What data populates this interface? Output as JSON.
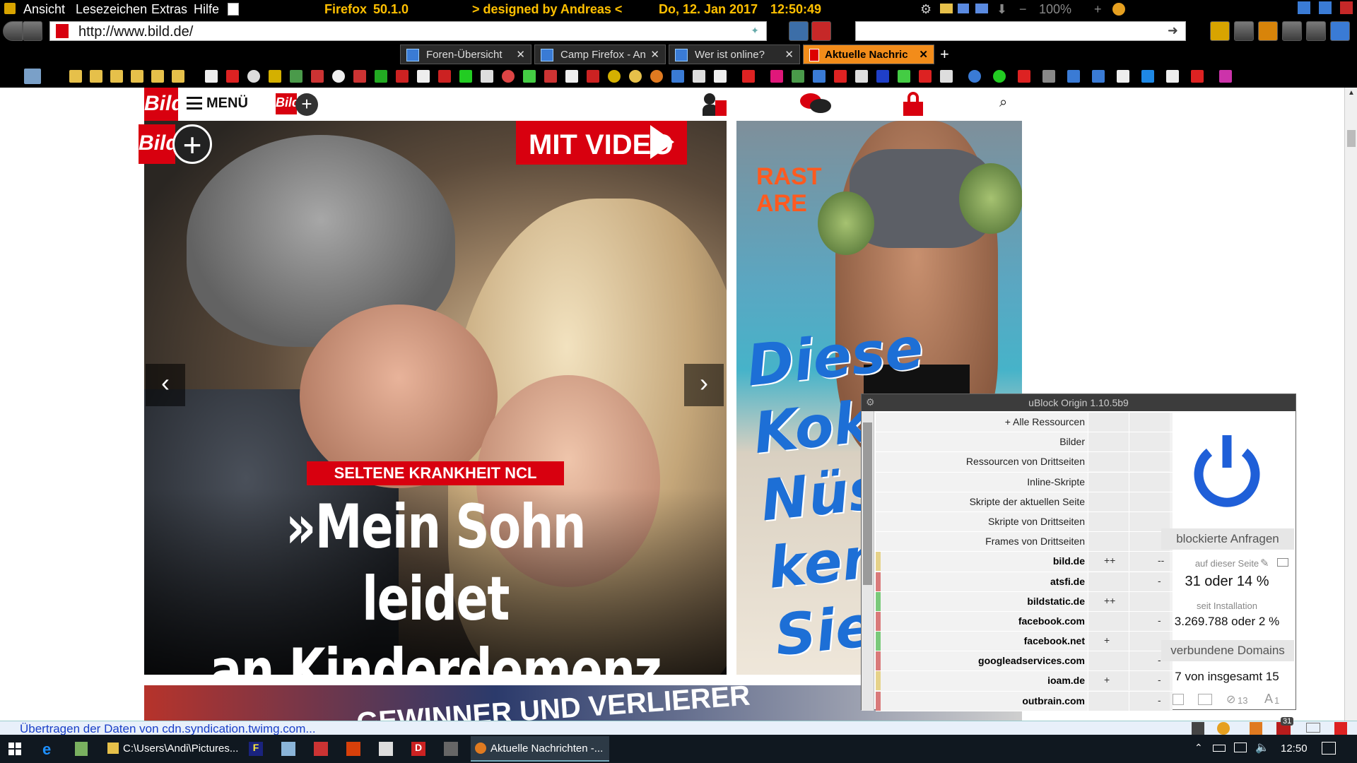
{
  "menubar": {
    "menus": [
      "Ansicht",
      "Lesezeichen",
      "Extras",
      "Hilfe"
    ],
    "browser": "Firefox",
    "version": "50.1.0",
    "designed": "> designed by Andreas <",
    "date": "Do, 12. Jan 2017",
    "time": "12:50:49",
    "zoom": "100%"
  },
  "navbar": {
    "url": "http://www.bild.de/",
    "search_value": ""
  },
  "tabs": [
    {
      "label": "Foren-Übersicht",
      "active": false
    },
    {
      "label": "Camp Firefox - An",
      "active": false
    },
    {
      "label": "Wer ist online?",
      "active": false
    },
    {
      "label": "Aktuelle Nachric",
      "active": true
    }
  ],
  "site": {
    "logo": "Bild",
    "menu_label": "MENÜ",
    "plus_logo": "Bild",
    "video_badge": "MIT VIDEO",
    "kicker": "SELTENE KRANKHEIT NCL",
    "headline_line1": "»Mein Sohn leidet",
    "headline_line2": "an Kinderdemenz",
    "ad_stars": "RASTARE",
    "ad_lines": [
      "Diese",
      "Koko",
      "Nüss",
      "kenne",
      "Sie..."
    ],
    "teaser_title": "GEWINNER UND VERLIERER"
  },
  "ublock": {
    "title": "uBlock Origin 1.10.5b9",
    "rows": [
      {
        "label": "+ Alle Ressourcen",
        "c1": "",
        "c2": "",
        "domain": false,
        "mark": ""
      },
      {
        "label": "Bilder",
        "c1": "",
        "c2": "",
        "domain": false,
        "mark": ""
      },
      {
        "label": "Ressourcen von Drittseiten",
        "c1": "",
        "c2": "",
        "domain": false,
        "mark": ""
      },
      {
        "label": "Inline-Skripte",
        "c1": "",
        "c2": "",
        "domain": false,
        "mark": ""
      },
      {
        "label": "Skripte der aktuellen Seite",
        "c1": "",
        "c2": "",
        "domain": false,
        "mark": ""
      },
      {
        "label": "Skripte von Drittseiten",
        "c1": "",
        "c2": "",
        "domain": false,
        "mark": ""
      },
      {
        "label": "Frames von Drittseiten",
        "c1": "",
        "c2": "",
        "domain": false,
        "mark": ""
      },
      {
        "label": "bild.de",
        "c1": "++",
        "c2": "--",
        "domain": true,
        "mark": "#e6d28a"
      },
      {
        "label": "atsfi.de",
        "c1": "",
        "c2": "-",
        "domain": true,
        "mark": "#d97a7a"
      },
      {
        "label": "bildstatic.de",
        "c1": "++",
        "c2": "",
        "domain": true,
        "mark": "#7ac97a"
      },
      {
        "label": "facebook.com",
        "c1": "",
        "c2": "-",
        "domain": true,
        "mark": "#d97a7a"
      },
      {
        "label": "facebook.net",
        "c1": "+",
        "c2": "",
        "domain": true,
        "mark": "#7ac97a"
      },
      {
        "label": "googleadservices.com",
        "c1": "",
        "c2": "-",
        "domain": true,
        "mark": "#d97a7a"
      },
      {
        "label": "ioam.de",
        "c1": "+",
        "c2": "-",
        "domain": true,
        "mark": "#e6d28a"
      },
      {
        "label": "outbrain.com",
        "c1": "",
        "c2": "-",
        "domain": true,
        "mark": "#d97a7a"
      }
    ],
    "blocked_header": "blockierte Anfragen",
    "on_page_label": "auf dieser Seite",
    "on_page_value": "31 oder 14 %",
    "since_install_label": "seit Installation",
    "since_install_value": "3.269.788 oder 2 %",
    "domains_header": "verbundene Domains",
    "domains_value": "7 von insgesamt 15",
    "tool_count_1": "13",
    "tool_count_2": "1",
    "power_color": "#1f5fd8"
  },
  "status": {
    "text": "Übertragen der Daten von cdn.syndication.twimg.com..."
  },
  "taskbar": {
    "tasks": [
      "C:\\Users\\Andi\\Pictures...",
      "Aktuelle Nachrichten -..."
    ],
    "time": "12:50",
    "badge": "31"
  }
}
